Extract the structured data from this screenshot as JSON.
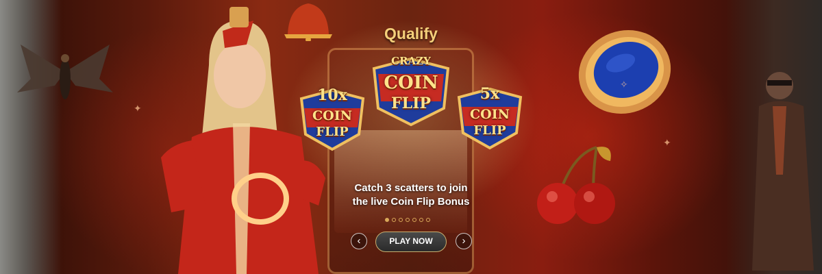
{
  "banner": {
    "heading": "Qualify",
    "badges": {
      "left": {
        "multiplier": "10x",
        "line1": "COIN",
        "line2": "FLIP"
      },
      "center": {
        "multiplier": "CRAZY",
        "line1": "COIN",
        "line2": "FLIP"
      },
      "right": {
        "multiplier": "5x",
        "line1": "COIN",
        "line2": "FLIP"
      }
    },
    "caption_line1": "Catch 3 scatters to join",
    "caption_line2": "the live Coin Flip Bonus",
    "play_button": "PLAY NOW",
    "prev_button": "‹",
    "next_button": "›",
    "slides": {
      "total": 7,
      "current": 1
    }
  },
  "colors": {
    "gold": "#f4cf7a",
    "badge_red": "#c62b22",
    "badge_blue": "#1f3c9c",
    "button_border": "#c9b070"
  },
  "icons": [
    "moth-ornament-icon",
    "bell-icon",
    "coin-portal-icon",
    "cherries-icon",
    "host-figure",
    "pirate-figure"
  ]
}
